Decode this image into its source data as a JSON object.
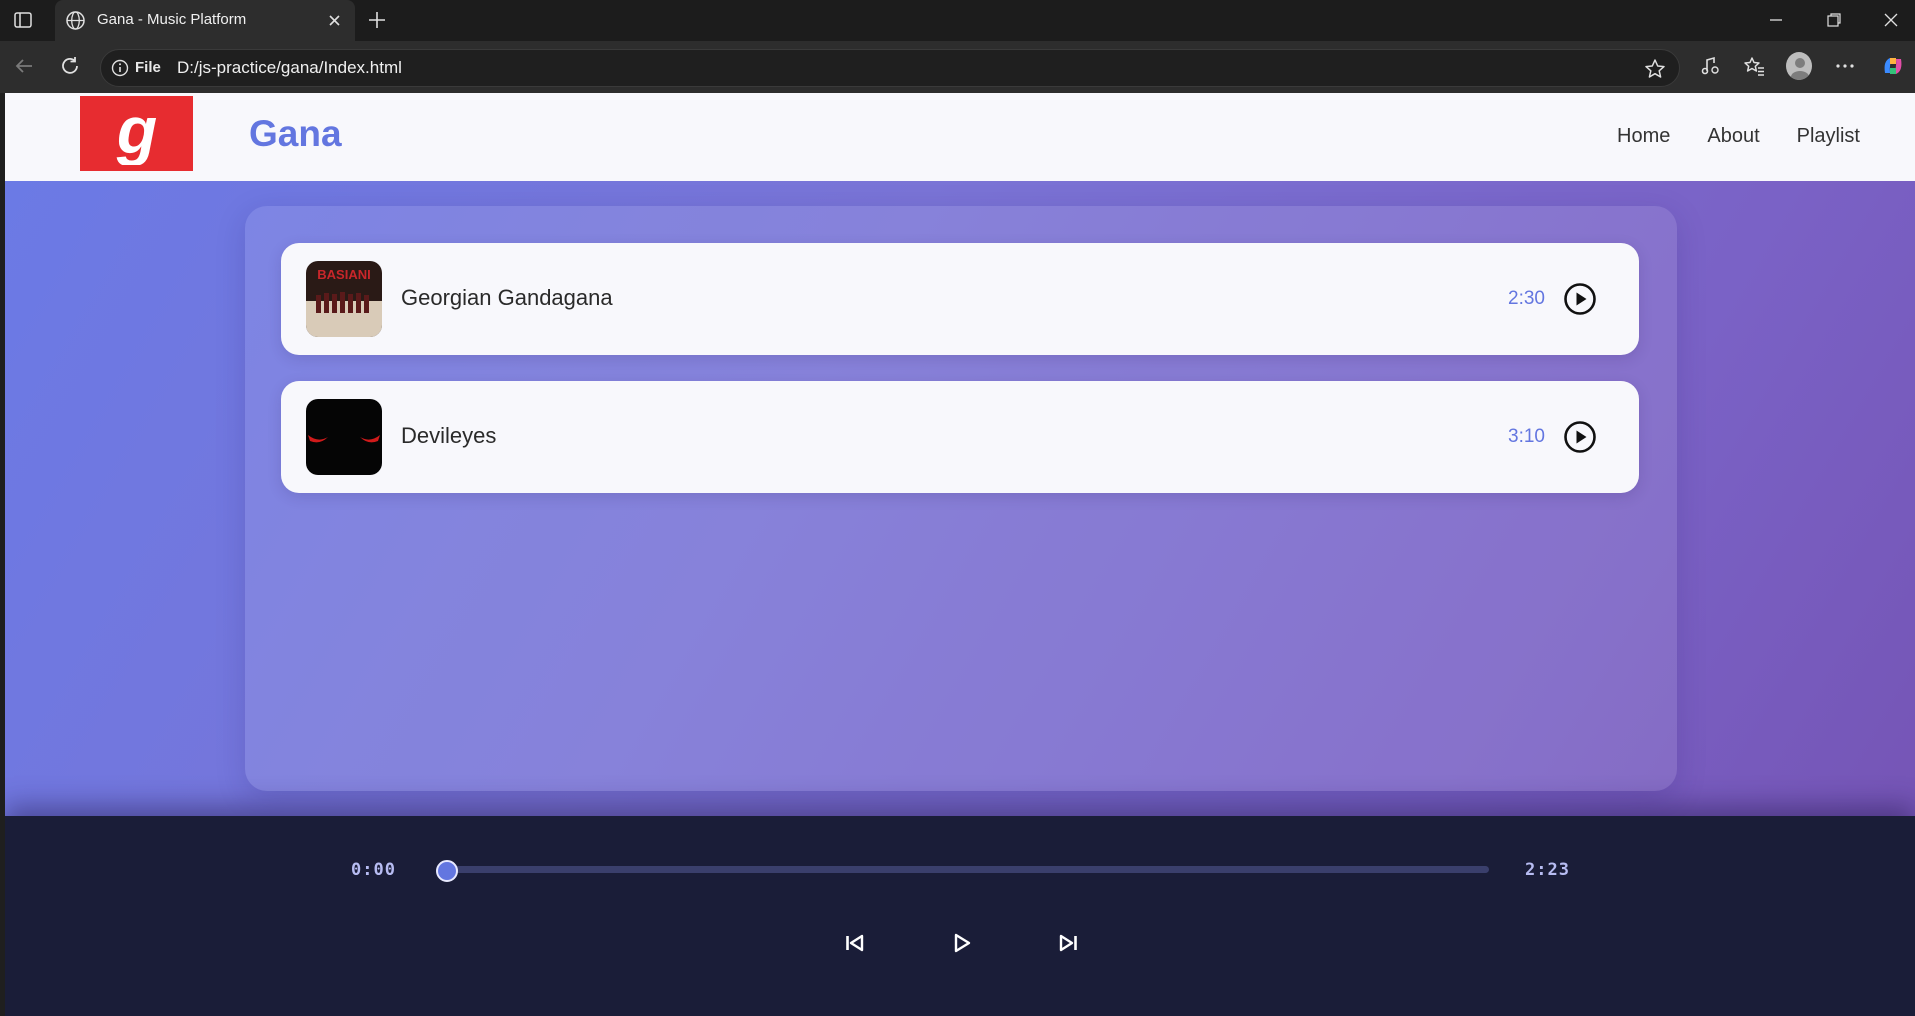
{
  "browser": {
    "tab_title": "Gana - Music Platform",
    "url_scheme_label": "File",
    "url": "D:/js-practice/gana/Index.html"
  },
  "site": {
    "logo_letter": "g",
    "brand": "Gana",
    "nav": [
      {
        "label": "Home"
      },
      {
        "label": "About"
      },
      {
        "label": "Playlist"
      }
    ]
  },
  "songs": [
    {
      "title": "Georgian Gandagana",
      "duration": "2:30",
      "cover_icon": "album-cover-basiani",
      "cover_text": "BASIANI"
    },
    {
      "title": "Devileyes",
      "duration": "3:10",
      "cover_icon": "album-cover-devil-eyes"
    }
  ],
  "player": {
    "current_time": "0:00",
    "total_time": "2:23",
    "progress": 0
  },
  "colors": {
    "accent": "#6376e0",
    "logo_red": "#e72c30",
    "player_bg": "#1a1d38"
  }
}
